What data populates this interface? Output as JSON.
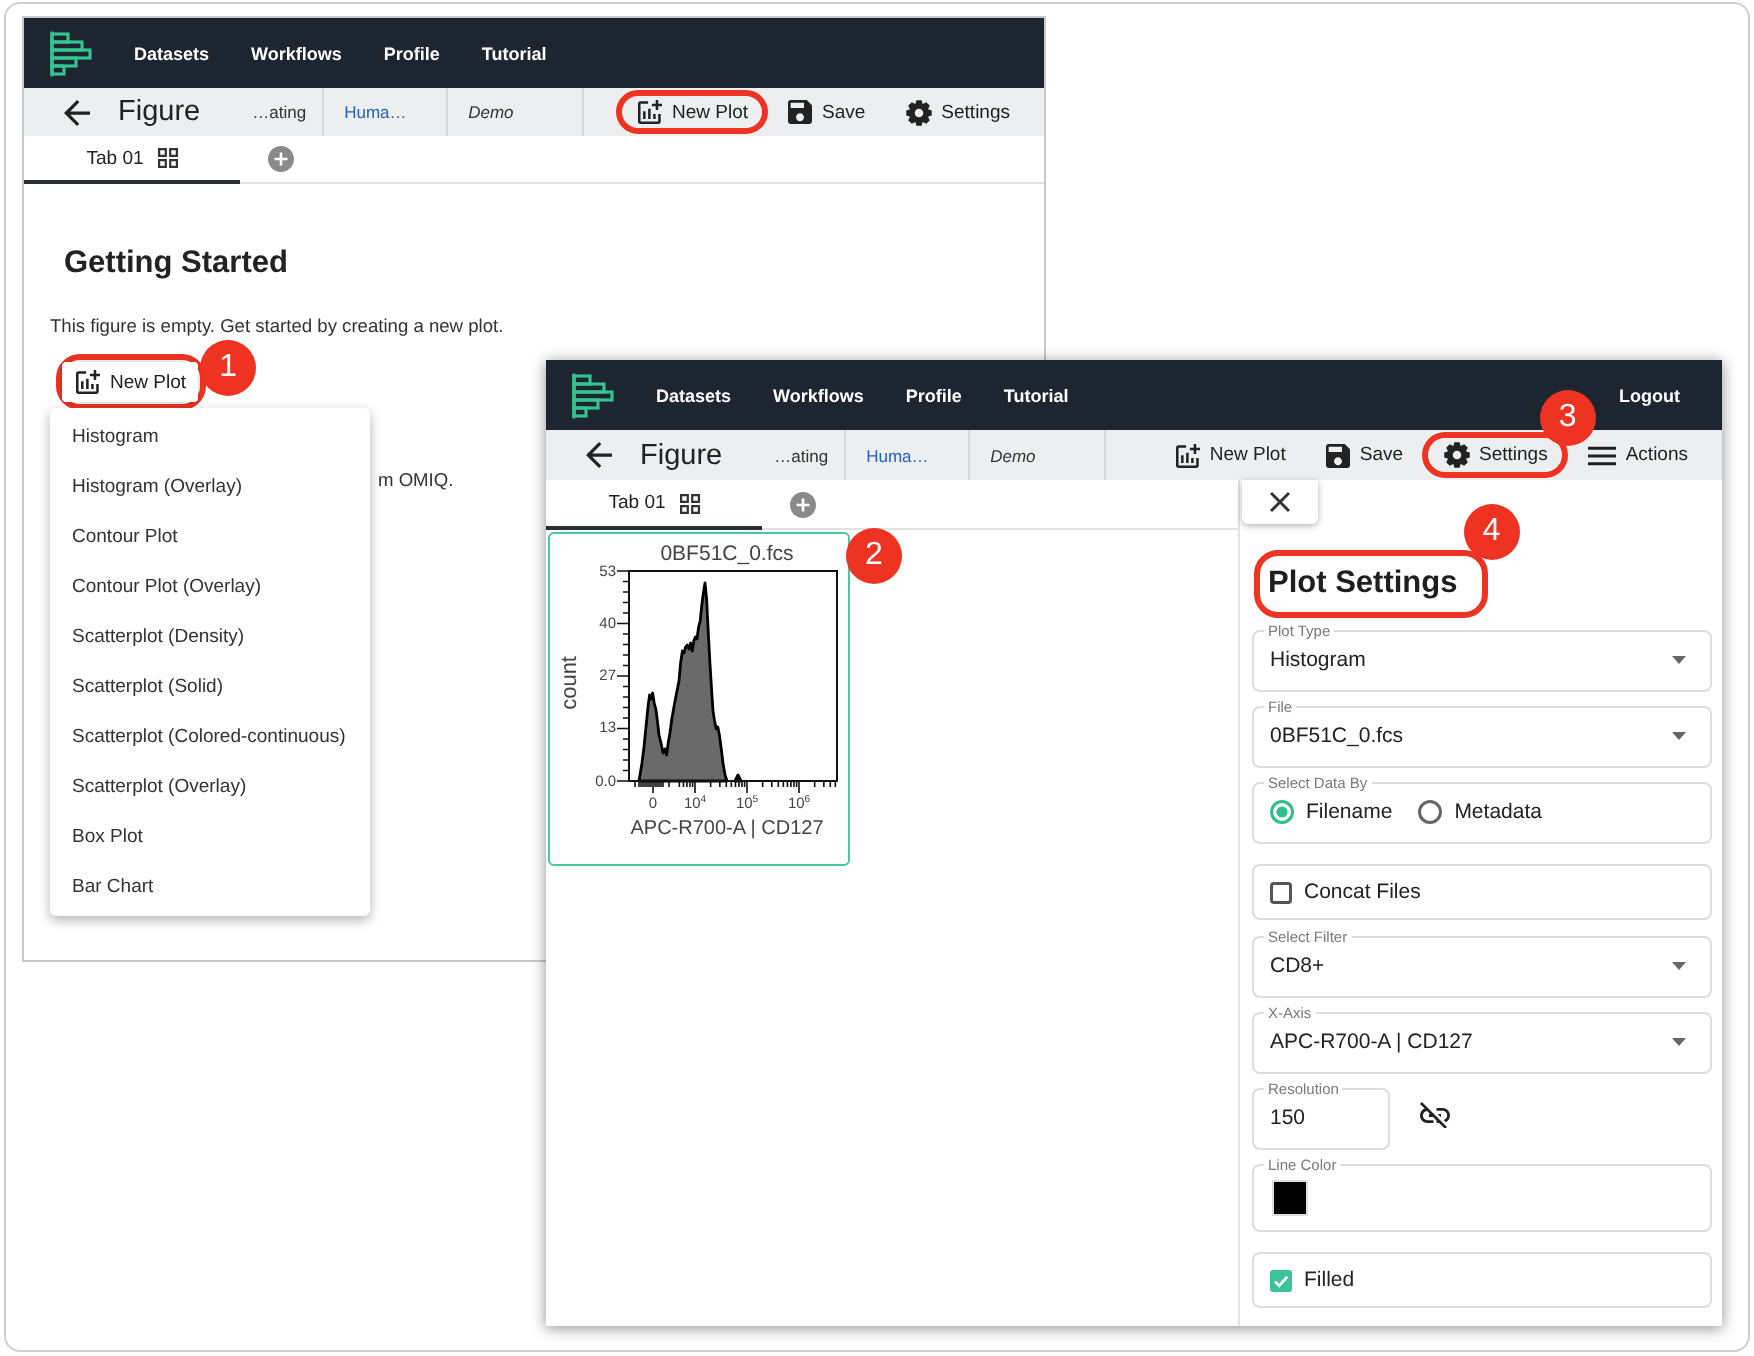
{
  "windows": [
    {
      "nav": {
        "links": [
          "Datasets",
          "Workflows",
          "Profile",
          "Tutorial"
        ]
      },
      "toolbar": {
        "title": "Figure",
        "crumbs": [
          {
            "kind": "plain",
            "label": "…ating"
          },
          {
            "kind": "link",
            "label": "Huma…"
          },
          {
            "kind": "italic",
            "label": "Demo"
          }
        ],
        "actions": [
          {
            "kind": "new_plot",
            "label": "New Plot",
            "highlighted": true
          },
          {
            "kind": "save",
            "label": "Save",
            "highlighted": false
          },
          {
            "kind": "settings",
            "label": "Settings",
            "highlighted": false
          }
        ]
      },
      "tabs": [
        {
          "label": "Tab 01",
          "selected": true
        }
      ],
      "content": {
        "kind": "empty",
        "heading": "Getting Started",
        "text": "This figure is empty. Get started by creating a new plot.",
        "button": {
          "label": "New Plot",
          "highlighted": true,
          "badge": "1"
        },
        "menu": [
          "Histogram",
          "Histogram (Overlay)",
          "Contour Plot",
          "Contour Plot (Overlay)",
          "Scatterplot (Density)",
          "Scatterplot (Solid)",
          "Scatterplot (Colored-continuous)",
          "Scatterplot (Overlay)",
          "Box Plot",
          "Bar Chart"
        ],
        "partial_text": "m OMIQ."
      }
    },
    {
      "nav": {
        "links": [
          "Datasets",
          "Workflows",
          "Profile",
          "Tutorial"
        ],
        "logout": "Logout"
      },
      "toolbar": {
        "title": "Figure",
        "crumbs": [
          {
            "kind": "plain",
            "label": "…ating"
          },
          {
            "kind": "link",
            "label": "Huma…"
          },
          {
            "kind": "italic",
            "label": "Demo"
          }
        ],
        "actions": [
          {
            "kind": "new_plot",
            "label": "New Plot",
            "highlighted": false
          },
          {
            "kind": "save",
            "label": "Save",
            "highlighted": false
          },
          {
            "kind": "settings",
            "label": "Settings",
            "highlighted": true,
            "badge": "3"
          },
          {
            "kind": "actions",
            "label": "Actions",
            "highlighted": false
          }
        ]
      },
      "tabs": [
        {
          "label": "Tab 01",
          "selected": true
        }
      ],
      "content": {
        "kind": "editor",
        "plots": [
          {
            "title": "0BF51C_0.fcs",
            "selected": true,
            "badge": "2",
            "y_label": "count",
            "y_ticks": [
              "53",
              "40",
              "27",
              "13",
              "0.0"
            ],
            "x_ticks": [
              "0",
              "10$^{4}$",
              "10$^{5}$",
              "10$^{6}$"
            ],
            "x_label": "APC-R700-A | CD127"
          }
        ],
        "settings": {
          "heading": "Plot Settings",
          "highlighted": true,
          "badge": "4",
          "fields": [
            {
              "kind": "select",
              "label": "Plot Type",
              "value": "Histogram"
            },
            {
              "kind": "select",
              "label": "File",
              "value": "0BF51C_0.fcs"
            },
            {
              "kind": "radio",
              "label": "Select Data By",
              "options": [
                {
                  "label": "Filename",
                  "selected": true
                },
                {
                  "label": "Metadata",
                  "selected": false
                }
              ]
            },
            {
              "kind": "checkbox",
              "label": "Concat Files",
              "checked": false
            },
            {
              "kind": "select",
              "label": "Select Filter",
              "value": "CD8+"
            },
            {
              "kind": "select",
              "label": "X-Axis",
              "value": "APC-R700-A | CD127"
            },
            {
              "kind": "number",
              "label": "Resolution",
              "value": "150",
              "linked": false
            },
            {
              "kind": "color",
              "label": "Line Color",
              "color": "#000000"
            },
            {
              "kind": "checkbox",
              "label": "Filled",
              "checked": true
            }
          ]
        }
      }
    }
  ]
}
